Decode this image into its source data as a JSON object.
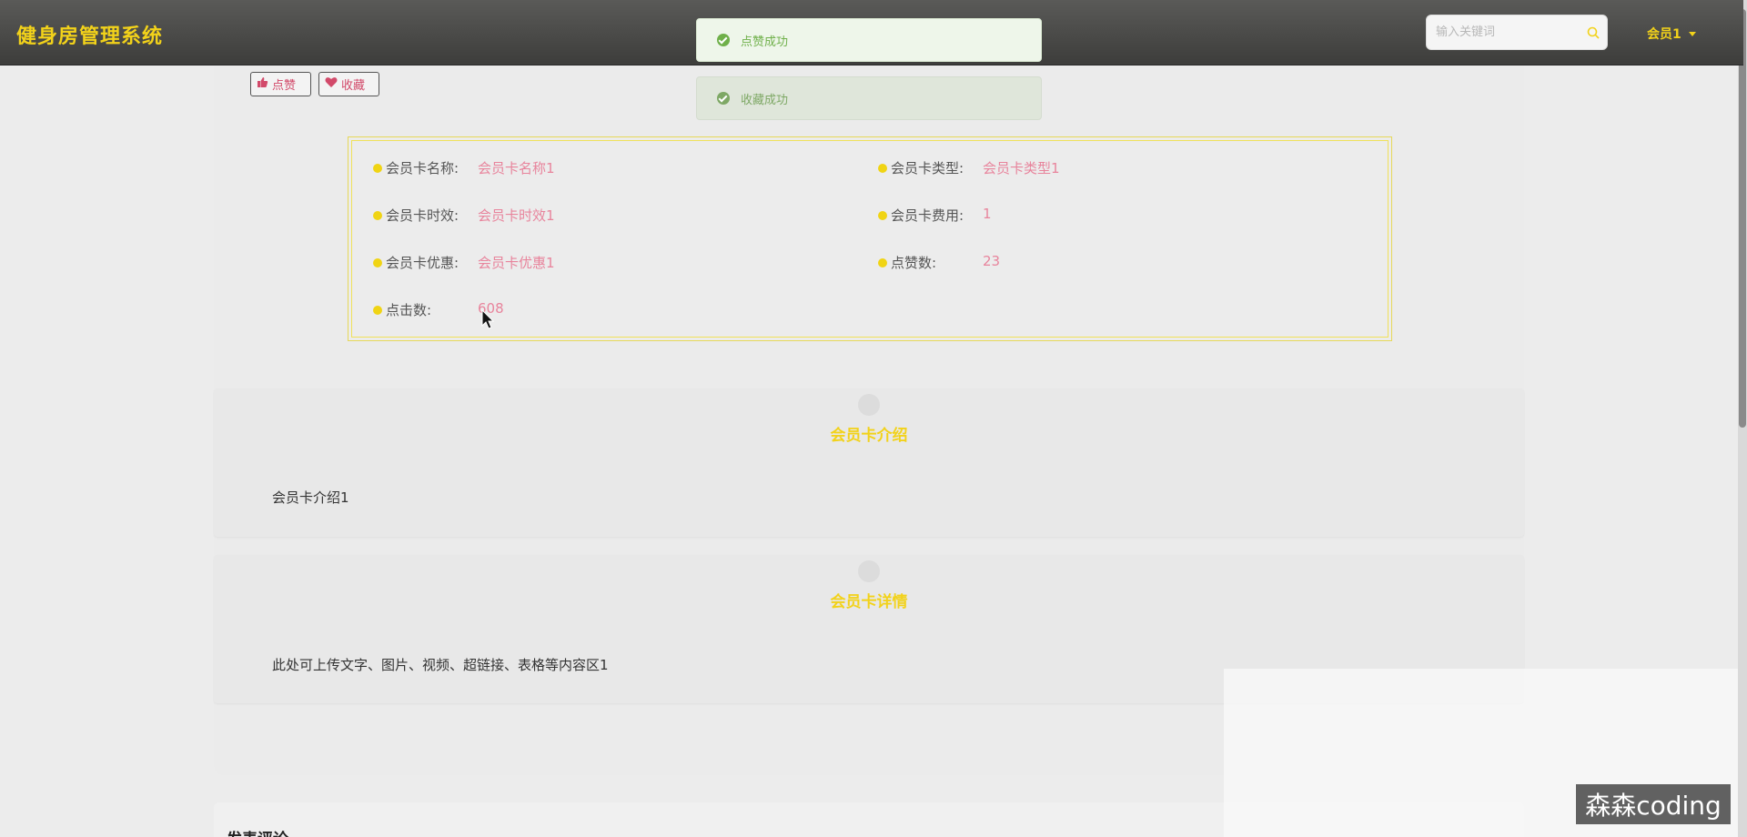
{
  "header": {
    "brand": "健身房管理系统",
    "search_placeholder": "输入关键词",
    "search_value": "",
    "user_label": "会员1"
  },
  "toasts": [
    {
      "text": "点赞成功"
    },
    {
      "text": "收藏成功"
    }
  ],
  "actions": {
    "like_label": "点赞",
    "favorite_label": "收藏"
  },
  "details": {
    "card_name_label": "会员卡名称:",
    "card_name_value": "会员卡名称1",
    "card_type_label": "会员卡类型:",
    "card_type_value": "会员卡类型1",
    "card_duration_label": "会员卡时效:",
    "card_duration_value": "会员卡时效1",
    "card_fee_label": "会员卡费用:",
    "card_fee_value": "1",
    "card_discount_label": "会员卡优惠:",
    "card_discount_value": "会员卡优惠1",
    "likes_label": "点赞数:",
    "likes_value": "23",
    "clicks_label": "点击数:",
    "clicks_value": "608"
  },
  "sections": {
    "intro_title": "会员卡介绍",
    "intro_text": "会员卡介绍1",
    "detail_title": "会员卡详情",
    "detail_text": "此处可上传文字、图片、视频、超链接、表格等内容区1"
  },
  "comments": {
    "title": "发表评论"
  },
  "watermark": "森森coding",
  "colors": {
    "accent": "#f2d21a",
    "value": "#e8849c",
    "success": "#6fb04a",
    "header_bg": "#4a4a48"
  }
}
